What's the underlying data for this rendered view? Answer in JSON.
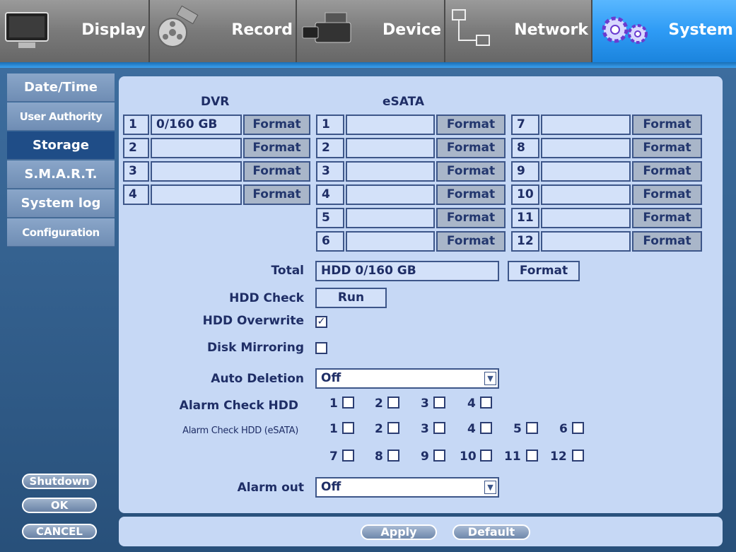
{
  "tabs": [
    {
      "label": "Display",
      "icon": "monitor-icon"
    },
    {
      "label": "Record",
      "icon": "film-reel-icon"
    },
    {
      "label": "Device",
      "icon": "camera-icon"
    },
    {
      "label": "Network",
      "icon": "network-icon"
    },
    {
      "label": "System",
      "icon": "gears-icon",
      "active": true
    }
  ],
  "sidebar": {
    "items": [
      {
        "label": "Date/Time"
      },
      {
        "label": "User Authority"
      },
      {
        "label": "Storage",
        "active": true
      },
      {
        "label": "S.M.A.R.T."
      },
      {
        "label": "System log"
      },
      {
        "label": "Configuration"
      }
    ],
    "shutdown": "Shutdown",
    "ok": "OK",
    "cancel": "CANCEL"
  },
  "storage": {
    "dvr_header": "DVR",
    "esata_header": "eSATA",
    "format_label": "Format",
    "dvr": [
      {
        "num": "1",
        "value": "0/160 GB"
      },
      {
        "num": "2",
        "value": ""
      },
      {
        "num": "3",
        "value": ""
      },
      {
        "num": "4",
        "value": ""
      }
    ],
    "esata_left": [
      {
        "num": "1",
        "value": ""
      },
      {
        "num": "2",
        "value": ""
      },
      {
        "num": "3",
        "value": ""
      },
      {
        "num": "4",
        "value": ""
      },
      {
        "num": "5",
        "value": ""
      },
      {
        "num": "6",
        "value": ""
      }
    ],
    "esata_right": [
      {
        "num": "7",
        "value": ""
      },
      {
        "num": "8",
        "value": ""
      },
      {
        "num": "9",
        "value": ""
      },
      {
        "num": "10",
        "value": ""
      },
      {
        "num": "11",
        "value": ""
      },
      {
        "num": "12",
        "value": ""
      }
    ]
  },
  "settings": {
    "total_label": "Total",
    "total_value": "HDD 0/160 GB",
    "total_format": "Format",
    "hdd_check_label": "HDD Check",
    "run_label": "Run",
    "hdd_overwrite_label": "HDD Overwrite",
    "hdd_overwrite_checked": true,
    "disk_mirroring_label": "Disk Mirroring",
    "disk_mirroring_checked": false,
    "auto_deletion_label": "Auto Deletion",
    "auto_deletion_value": "Off",
    "alarm_check_hdd_label": "Alarm Check HDD",
    "alarm_check_hdd": [
      "1",
      "2",
      "3",
      "4"
    ],
    "alarm_check_esata_label": "Alarm Check HDD (eSATA)",
    "alarm_check_esata": [
      "1",
      "2",
      "3",
      "4",
      "5",
      "6",
      "7",
      "8",
      "9",
      "10",
      "11",
      "12"
    ],
    "alarm_out_label": "Alarm out",
    "alarm_out_value": "Off"
  },
  "footer": {
    "apply": "Apply",
    "default": "Default"
  },
  "colors": {
    "active_tab": "#2e9bf5",
    "panel_bg": "#c6d8f5",
    "label_text": "#1f2e66",
    "sidebar_active": "#1f4d87"
  }
}
